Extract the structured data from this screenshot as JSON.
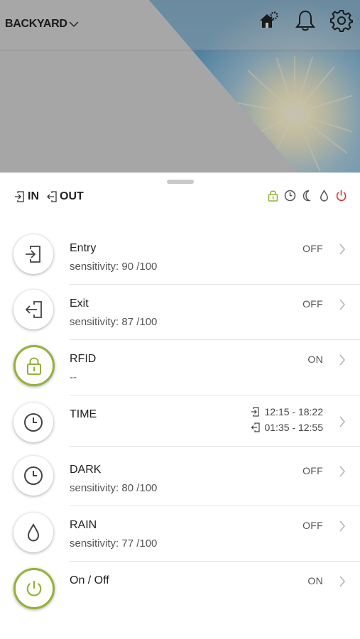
{
  "header": {
    "location": "BACKYARD",
    "icons": [
      "home-gear-icon",
      "bell-icon",
      "gear-icon"
    ]
  },
  "sheet": {
    "in_label": "IN",
    "out_label": "OUT",
    "status_icons": [
      "lock-icon",
      "clock-icon",
      "moon-icon",
      "drop-icon",
      "power-icon"
    ],
    "colors": {
      "accent": "#93b236",
      "power": "#e0302a",
      "text": "#222222"
    }
  },
  "rows": [
    {
      "title": "Entry",
      "subtitle": "sensitivity: 90 /100",
      "state": "OFF",
      "icon": "entry-icon"
    },
    {
      "title": "Exit",
      "subtitle": "sensitivity: 87 /100",
      "state": "OFF",
      "icon": "exit-icon"
    },
    {
      "title": "RFID",
      "subtitle": "--",
      "state": "ON",
      "icon": "lock-icon"
    },
    {
      "title": "TIME",
      "in_time": "12:15 - 18:22",
      "out_time": "01:35 - 12:55",
      "icon": "clock-icon"
    },
    {
      "title": "DARK",
      "subtitle": "sensitivity: 80 /100",
      "state": "OFF",
      "icon": "clock-icon"
    },
    {
      "title": "RAIN",
      "subtitle": "sensitivity: 77 /100",
      "state": "OFF",
      "icon": "drop-icon"
    },
    {
      "title": "On / Off",
      "state": "ON",
      "icon": "power-icon"
    }
  ]
}
